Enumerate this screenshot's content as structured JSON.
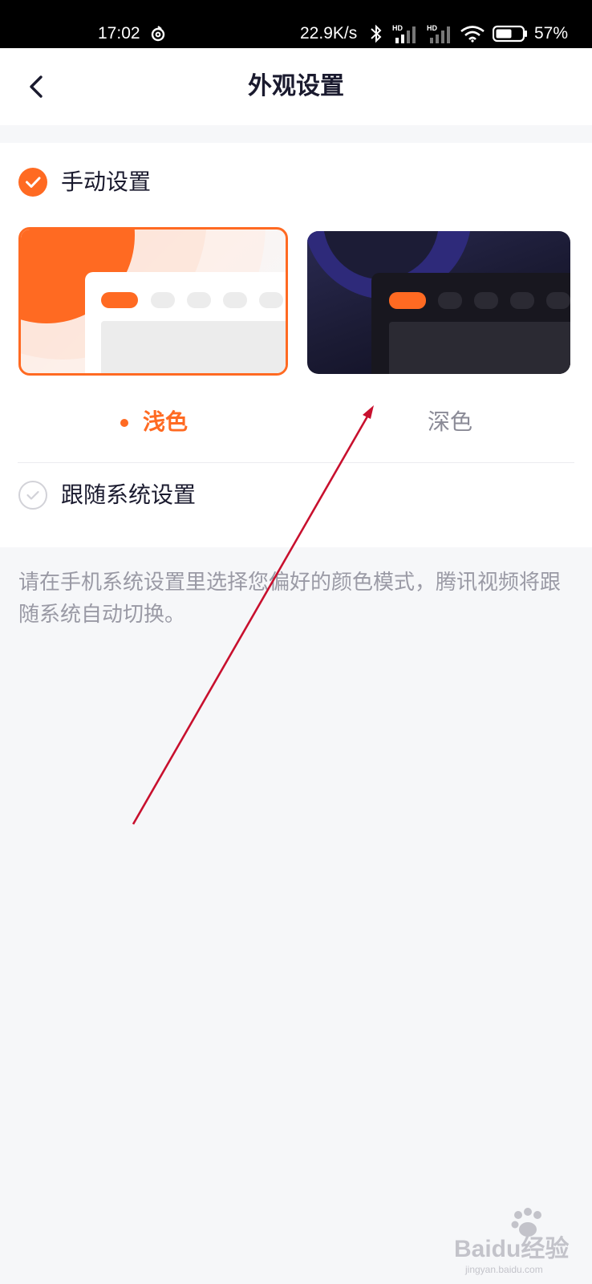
{
  "status_bar": {
    "time": "17:02",
    "network_speed": "22.9K/s",
    "signal_1_label": "HD",
    "signal_2_label": "HD",
    "battery": "57%",
    "icons": [
      "loop-icon",
      "bluetooth-icon",
      "signal-icon",
      "wifi-icon",
      "battery-icon"
    ]
  },
  "header": {
    "title": "外观设置",
    "back_icon": "chevron-left-icon"
  },
  "appearance": {
    "manual": {
      "label": "手动设置",
      "checked": true
    },
    "themes": [
      {
        "label": "浅色",
        "selected": true
      },
      {
        "label": "深色",
        "selected": false
      }
    ],
    "follow_system": {
      "label": "跟随系统设置",
      "checked": false
    },
    "hint": "请在手机系统设置里选择您偏好的颜色模式，腾讯视频将跟随系统自动切换。"
  },
  "watermark": {
    "text": "Baidu经验",
    "sub": "jingyan.baidu.com"
  },
  "colors": {
    "accent": "#ff6a22",
    "title": "#1a1a2e",
    "muted": "#9a9aa5",
    "background": "#f6f7f9",
    "annotation": "#c8102e"
  }
}
